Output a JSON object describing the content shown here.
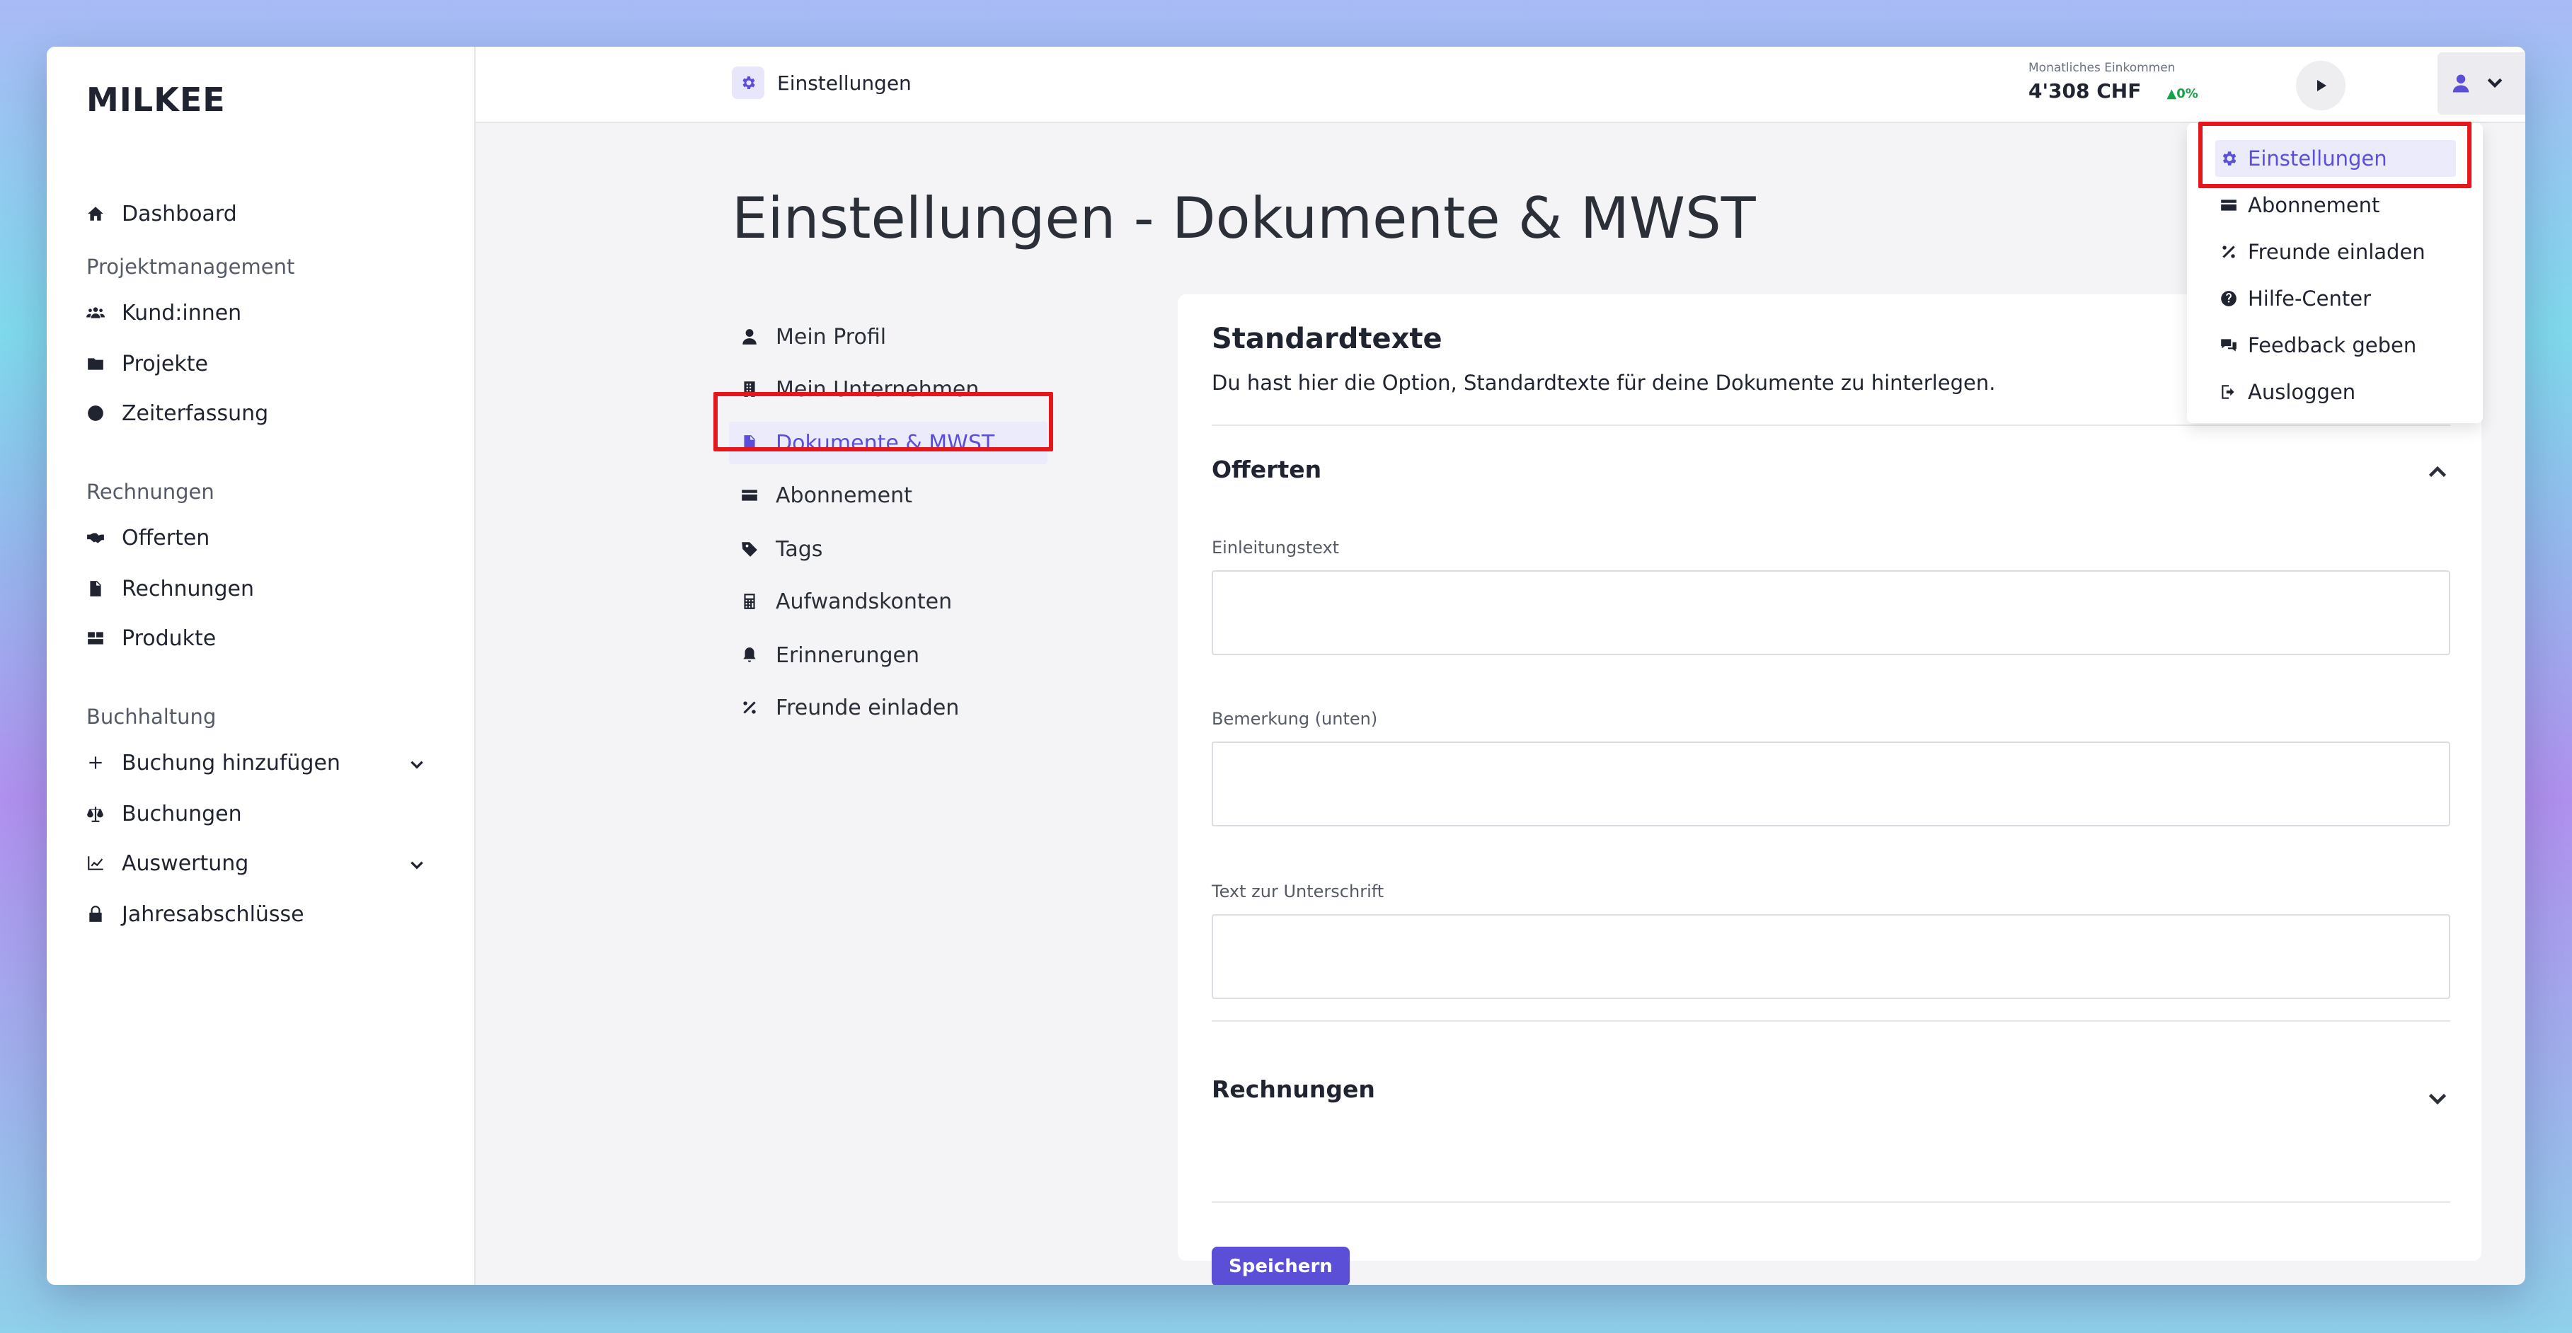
{
  "brand": "MILKEE",
  "sidebar": {
    "dashboard": "Dashboard",
    "sections": {
      "project": "Projektmanagement",
      "invoices": "Rechnungen",
      "accounting": "Buchhaltung"
    },
    "items": {
      "customers": "Kund:innen",
      "projects": "Projekte",
      "time": "Zeiterfassung",
      "offers": "Offerten",
      "invoices": "Rechnungen",
      "products": "Produkte",
      "add_booking": "Buchung hinzufügen",
      "bookings": "Buchungen",
      "evaluation": "Auswertung",
      "annual": "Jahresabschlüsse"
    }
  },
  "header": {
    "breadcrumb": "Einstellungen",
    "income_label": "Monatliches Einkommen",
    "income_value": "4'308 CHF",
    "income_trend": "0%"
  },
  "main": {
    "title": "Einstellungen - Dokumente & MWST",
    "subnav": {
      "profile": "Mein Profil",
      "company": "Mein Unternehmen",
      "documents": "Dokumente & MWST",
      "subscription": "Abonnement",
      "tags": "Tags",
      "expense": "Aufwandskonten",
      "reminders": "Erinnerungen",
      "invite": "Freunde einladen"
    },
    "card": {
      "title": "Standardtexte",
      "description": "Du hast hier die Option, Standardtexte für deine Dokumente zu hinterlegen.",
      "offers_heading": "Offerten",
      "intro_label": "Einleitungstext",
      "remark_label": "Bemerkung (unten)",
      "signature_label": "Text zur Unterschrift",
      "invoices_heading": "Rechnungen",
      "save": "Speichern"
    }
  },
  "user_menu": {
    "settings": "Einstellungen",
    "subscription": "Abonnement",
    "invite": "Freunde einladen",
    "help": "Hilfe-Center",
    "feedback": "Feedback geben",
    "logout": "Ausloggen"
  },
  "colors": {
    "accent": "#5a4fd6",
    "highlight": "#e5161c",
    "trend_up": "#16a34a"
  }
}
